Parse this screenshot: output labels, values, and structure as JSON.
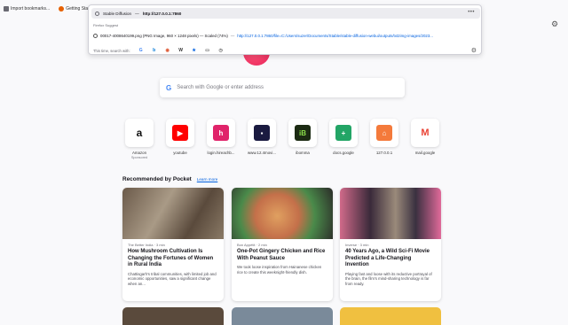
{
  "bookmarks": [
    {
      "label": "Import bookmarks...",
      "color": "#6a6a72"
    },
    {
      "label": "Getting Started",
      "color": "#e66000"
    }
  ],
  "urlbar": {
    "title": "Stable Diffusion",
    "url": "http://127.0.0.1:7860",
    "separator": "—",
    "more": "•••"
  },
  "suggest": {
    "header": "Firefox Suggest",
    "item_title": "00017-4008640199.png (PNG Image, 960 × 1248 pixels) — Scaled (74%)",
    "sep": "—",
    "item_url": "http://127.0.0.1:7860",
    "item_path": "/file=C:/Users/suzer/Documents/Stable/stable-diffusion-webui/outputs/txt2img-images/2023..."
  },
  "searchwith": {
    "label": "This time, search with:",
    "engines": [
      {
        "icon": "google-icon",
        "glyph": "G",
        "color": "#4285f4"
      },
      {
        "icon": "bing-icon",
        "glyph": "b",
        "color": "#0078d7"
      },
      {
        "icon": "duckduckgo-icon",
        "glyph": "◉",
        "color": "#de5833"
      },
      {
        "icon": "wikipedia-icon",
        "glyph": "W",
        "color": "#333333"
      },
      {
        "icon": "bookmark-star-icon",
        "glyph": "★",
        "color": "#0060df"
      },
      {
        "icon": "tabs-icon",
        "glyph": "▭",
        "color": "#555555"
      },
      {
        "icon": "history-icon",
        "glyph": "◷",
        "color": "#555555"
      }
    ]
  },
  "search": {
    "placeholder": "Search with Google or enter address"
  },
  "tiles": [
    {
      "label": "Amazon",
      "sub": "Sponsored",
      "glyph": "a",
      "color": "#ffffff",
      "fg": "#111111"
    },
    {
      "label": "youtube",
      "sub": "",
      "glyph": "▶",
      "color": "#ff0000",
      "fg": "#ffffff"
    },
    {
      "label": "login.hireachb...",
      "sub": "",
      "glyph": "h",
      "color": "#e0246a",
      "fg": "#ffffff"
    },
    {
      "label": "www.12.4movi...",
      "sub": "",
      "glyph": "▪",
      "color": "#1a1a40",
      "fg": "#ffffff"
    },
    {
      "label": "ibomma",
      "sub": "",
      "glyph": "iB",
      "color": "#1c2b13",
      "fg": "#8ce04a"
    },
    {
      "label": "docs.google",
      "sub": "",
      "glyph": "+",
      "color": "#23a566",
      "fg": "#ffffff"
    },
    {
      "label": "127.0.0.1",
      "sub": "",
      "glyph": "⌂",
      "color": "#f47a3b",
      "fg": "#ffffff"
    },
    {
      "label": "mail.google",
      "sub": "",
      "glyph": "M",
      "color": "#ffffff",
      "fg": "#ea4335"
    }
  ],
  "pocket": {
    "title": "Recommended by Pocket",
    "learn": "Learn more",
    "cards": [
      {
        "source": "The Better India · 3 min",
        "title": "How Mushroom Cultivation Is Changing the Fortunes of Women in Rural India",
        "excerpt": "Chattisgarh's tribal communities, with limited job and economic opportunities, saw a significant change when an...",
        "img": "linear-gradient(120deg,#6b5a4a,#a99a86 40%,#5a4a3c 70%,#8a7a66)"
      },
      {
        "source": "Bon Appétit · 2 min",
        "title": "One-Pot Gingery Chicken and Rice With Peanut Sauce",
        "excerpt": "We took loose inspiration from Hainanese chicken rice to create this weeknight-friendly dish.",
        "img": "radial-gradient(circle at 45% 55%,#e0a060,#c4704a 35%,#4a8a4a 60%,#2b2a28)"
      },
      {
        "source": "Inverse · 3 min",
        "title": "40 Years Ago, a Wild Sci-Fi Movie Predicted a Life-Changing Invention",
        "excerpt": "Playing fast and loose with its reductive portrayal of the brain, the film's mind-sharing technology is far from ready.",
        "img": "linear-gradient(90deg,#d06a8a,#3a2a3a 30%,#9a8a7a 55%,#3a3040 75%,#e06a9a)"
      }
    ]
  },
  "row2": [
    {
      "color": "#5a4a3c"
    },
    {
      "color": "#7a8a9a"
    },
    {
      "color": "#f0c040"
    }
  ]
}
